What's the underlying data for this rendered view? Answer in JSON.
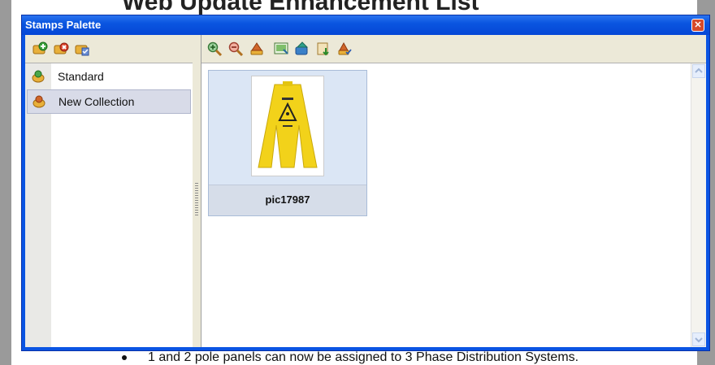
{
  "background": {
    "heading_text": "Web Update Enhancement List",
    "bullet_text": "1 and 2 pole panels can now be assigned to 3 Phase Distribution Systems."
  },
  "window": {
    "title": "Stamps Palette",
    "close_glyph": "✕"
  },
  "left_toolbar": {
    "icons": [
      "add-collection-icon",
      "delete-collection-icon",
      "collection-properties-icon"
    ]
  },
  "collections": [
    {
      "label": "Standard",
      "icon": "stamp-collection-icon",
      "selected": false
    },
    {
      "label": "New Collection",
      "icon": "stamp-collection-icon",
      "selected": true
    }
  ],
  "right_toolbar": {
    "icons": [
      "zoom-in-icon",
      "zoom-out-icon",
      "apply-stamp-icon",
      "add-image-icon",
      "import-stamp-icon",
      "export-stamp-icon",
      "stamp-properties-icon"
    ]
  },
  "stamps": [
    {
      "label": "pic17987",
      "thumbnail": "yellow-caution-sign"
    }
  ],
  "colors": {
    "titlebar": "#0a54e3",
    "selection": "#d8dbe8",
    "card": "#dbe6f5"
  }
}
